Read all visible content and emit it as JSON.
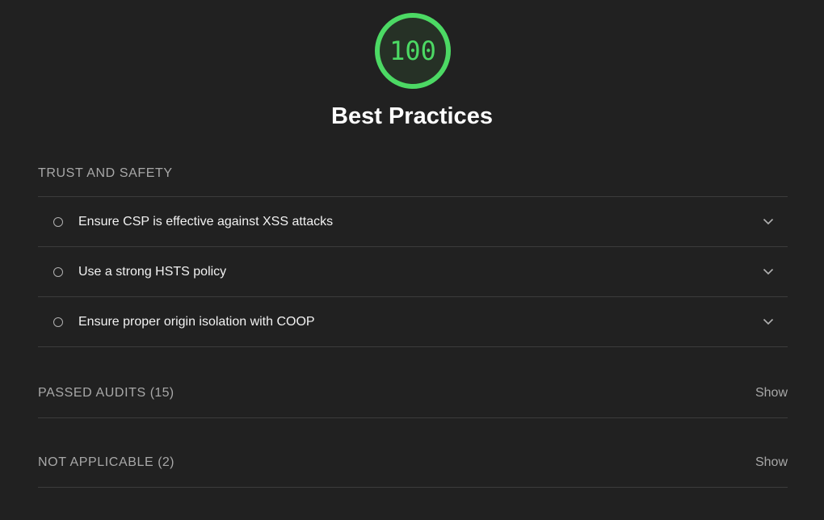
{
  "gauge": {
    "score": "100",
    "score_fraction": 1.0,
    "color": "#4cd964"
  },
  "category": {
    "title": "Best Practices"
  },
  "group": {
    "title": "TRUST AND SAFETY",
    "audits": [
      {
        "title": "Ensure CSP is effective against XSS attacks"
      },
      {
        "title": "Use a strong HSTS policy"
      },
      {
        "title": "Ensure proper origin isolation with COOP"
      }
    ]
  },
  "passed": {
    "title": "PASSED AUDITS",
    "count": "(15)",
    "toggle": "Show"
  },
  "not_applicable": {
    "title": "NOT APPLICABLE",
    "count": "(2)",
    "toggle": "Show"
  }
}
